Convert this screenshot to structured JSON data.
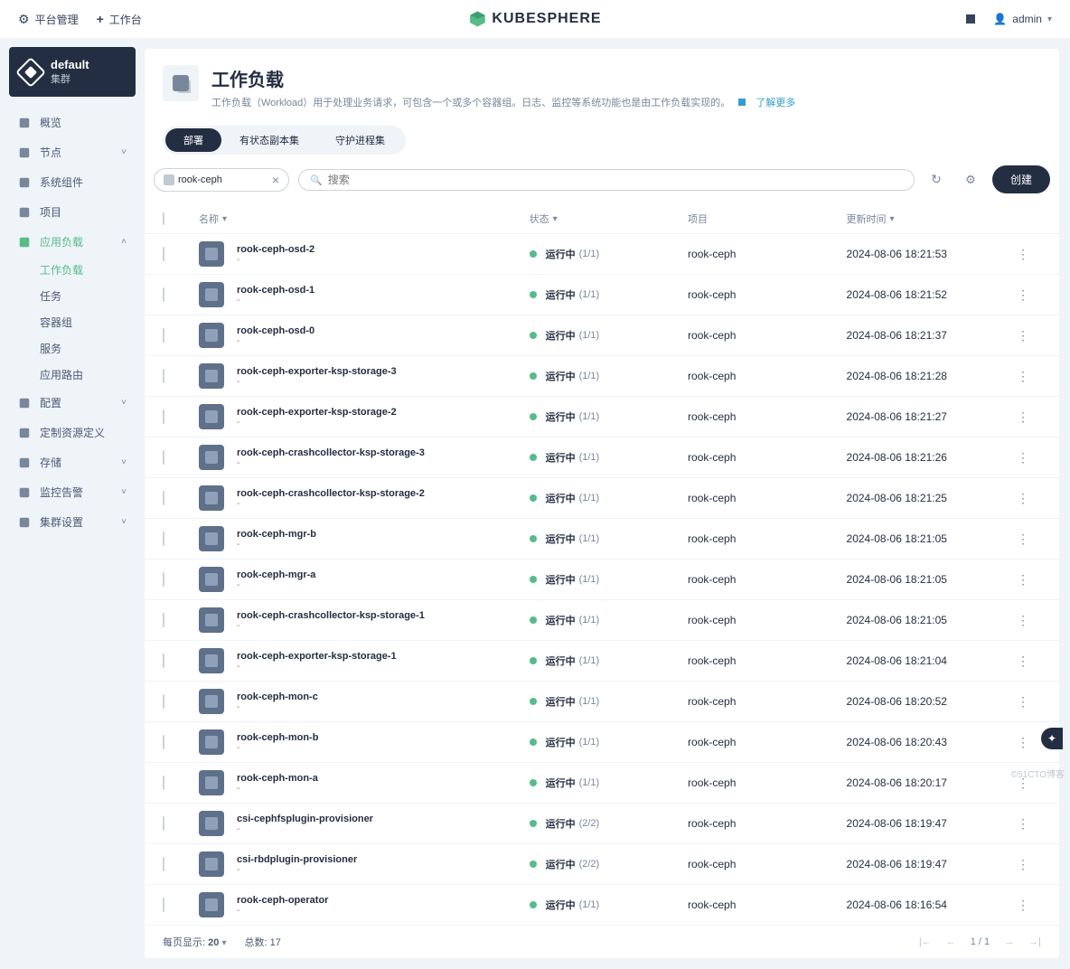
{
  "topbar": {
    "platform_mgmt": "平台管理",
    "workbench": "工作台",
    "brand": "KUBESPHERE",
    "user": "admin"
  },
  "cluster": {
    "name": "default",
    "label": "集群"
  },
  "sidebar": {
    "items": [
      {
        "label": "概览",
        "icon": "dashboard-icon"
      },
      {
        "label": "节点",
        "icon": "nodes-icon",
        "expandable": true
      },
      {
        "label": "系统组件",
        "icon": "components-icon"
      },
      {
        "label": "项目",
        "icon": "project-icon"
      },
      {
        "label": "应用负载",
        "icon": "appload-icon",
        "active": true,
        "expanded": true,
        "children": [
          {
            "label": "工作负载",
            "active": true
          },
          {
            "label": "任务"
          },
          {
            "label": "容器组"
          },
          {
            "label": "服务"
          },
          {
            "label": "应用路由"
          }
        ]
      },
      {
        "label": "配置",
        "icon": "config-icon",
        "expandable": true
      },
      {
        "label": "定制资源定义",
        "icon": "crd-icon"
      },
      {
        "label": "存储",
        "icon": "storage-icon",
        "expandable": true
      },
      {
        "label": "监控告警",
        "icon": "monitor-icon",
        "expandable": true
      },
      {
        "label": "集群设置",
        "icon": "settings-icon",
        "expandable": true
      }
    ]
  },
  "page": {
    "title": "工作负载",
    "description": "工作负载（Workload）用于处理业务请求，可包含一个或多个容器组。日志、监控等系统功能也是由工作负载实现的。",
    "learn_more": "了解更多"
  },
  "tabs": [
    {
      "label": "部署",
      "active": true
    },
    {
      "label": "有状态副本集"
    },
    {
      "label": "守护进程集"
    }
  ],
  "toolbar": {
    "filter_value": "rook-ceph",
    "search_placeholder": "搜索",
    "create_label": "创建"
  },
  "columns": {
    "name": "名称",
    "status": "状态",
    "project": "项目",
    "updated": "更新时间"
  },
  "status_label": "运行中",
  "rows": [
    {
      "name": "rook-ceph-osd-2",
      "ratio": "(1/1)",
      "project": "rook-ceph",
      "time": "2024-08-06 18:21:53"
    },
    {
      "name": "rook-ceph-osd-1",
      "ratio": "(1/1)",
      "project": "rook-ceph",
      "time": "2024-08-06 18:21:52"
    },
    {
      "name": "rook-ceph-osd-0",
      "ratio": "(1/1)",
      "project": "rook-ceph",
      "time": "2024-08-06 18:21:37"
    },
    {
      "name": "rook-ceph-exporter-ksp-storage-3",
      "ratio": "(1/1)",
      "project": "rook-ceph",
      "time": "2024-08-06 18:21:28"
    },
    {
      "name": "rook-ceph-exporter-ksp-storage-2",
      "ratio": "(1/1)",
      "project": "rook-ceph",
      "time": "2024-08-06 18:21:27"
    },
    {
      "name": "rook-ceph-crashcollector-ksp-storage-3",
      "ratio": "(1/1)",
      "project": "rook-ceph",
      "time": "2024-08-06 18:21:26"
    },
    {
      "name": "rook-ceph-crashcollector-ksp-storage-2",
      "ratio": "(1/1)",
      "project": "rook-ceph",
      "time": "2024-08-06 18:21:25"
    },
    {
      "name": "rook-ceph-mgr-b",
      "ratio": "(1/1)",
      "project": "rook-ceph",
      "time": "2024-08-06 18:21:05"
    },
    {
      "name": "rook-ceph-mgr-a",
      "ratio": "(1/1)",
      "project": "rook-ceph",
      "time": "2024-08-06 18:21:05"
    },
    {
      "name": "rook-ceph-crashcollector-ksp-storage-1",
      "ratio": "(1/1)",
      "project": "rook-ceph",
      "time": "2024-08-06 18:21:05"
    },
    {
      "name": "rook-ceph-exporter-ksp-storage-1",
      "ratio": "(1/1)",
      "project": "rook-ceph",
      "time": "2024-08-06 18:21:04"
    },
    {
      "name": "rook-ceph-mon-c",
      "ratio": "(1/1)",
      "project": "rook-ceph",
      "time": "2024-08-06 18:20:52"
    },
    {
      "name": "rook-ceph-mon-b",
      "ratio": "(1/1)",
      "project": "rook-ceph",
      "time": "2024-08-06 18:20:43"
    },
    {
      "name": "rook-ceph-mon-a",
      "ratio": "(1/1)",
      "project": "rook-ceph",
      "time": "2024-08-06 18:20:17"
    },
    {
      "name": "csi-cephfsplugin-provisioner",
      "ratio": "(2/2)",
      "project": "rook-ceph",
      "time": "2024-08-06 18:19:47"
    },
    {
      "name": "csi-rbdplugin-provisioner",
      "ratio": "(2/2)",
      "project": "rook-ceph",
      "time": "2024-08-06 18:19:47"
    },
    {
      "name": "rook-ceph-operator",
      "ratio": "(1/1)",
      "project": "rook-ceph",
      "time": "2024-08-06 18:16:54"
    }
  ],
  "footer": {
    "page_size_label": "每页显示:",
    "page_size": "20",
    "total_label": "总数:",
    "total": "17",
    "page_current": "1",
    "page_total": "1"
  },
  "watermark": "©51CTO博客"
}
